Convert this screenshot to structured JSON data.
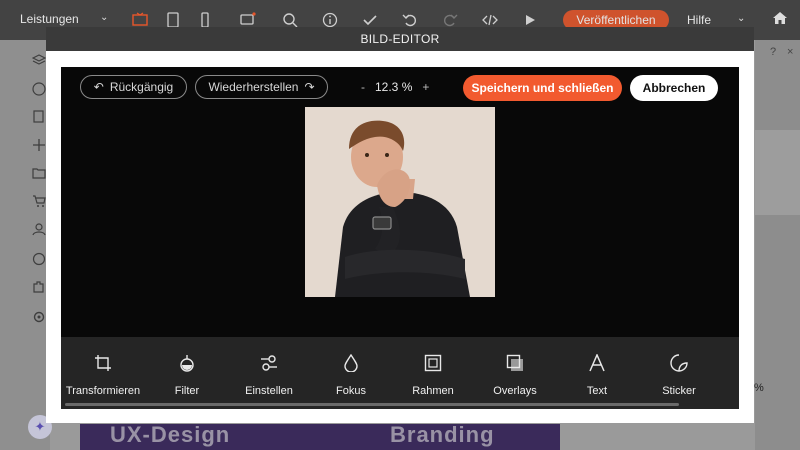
{
  "topbar": {
    "dropdown_label": "Leistungen",
    "publish_label": "Veröffentlichen",
    "help_label": "Hilfe",
    "icons": [
      "desktop-icon",
      "tablet-icon",
      "mobile-icon",
      "comment-icon",
      "search-icon",
      "info-icon",
      "check-icon",
      "undo-icon",
      "redo-icon",
      "code-icon",
      "play-icon",
      "home-icon"
    ],
    "accent_color": "#e8562a"
  },
  "sidebar": {
    "icons": [
      "layers-icon",
      "palette-icon",
      "pages-icon",
      "add-icon",
      "folder-icon",
      "cart-icon",
      "user-icon",
      "chat-icon",
      "puzzle-icon",
      "settings-icon",
      "magic-icon"
    ]
  },
  "right_panel": {
    "help": "?",
    "close": "×",
    "percent": "%"
  },
  "background_content": {
    "text_left": "UX-Design",
    "text_right": "Branding"
  },
  "modal": {
    "title": "BILD-EDITOR",
    "undo_label": "Rückgängig",
    "redo_label": "Wiederherstellen",
    "zoom_minus": "-",
    "zoom_value": "12.3 %",
    "zoom_plus": "+",
    "save_label": "Speichern und schließen",
    "cancel_label": "Abbrechen",
    "save_color": "#f25a2f",
    "tools": [
      {
        "label": "Transformieren",
        "icon": "crop-icon"
      },
      {
        "label": "Filter",
        "icon": "filter-icon"
      },
      {
        "label": "Einstellen",
        "icon": "adjust-icon"
      },
      {
        "label": "Fokus",
        "icon": "focus-drop-icon"
      },
      {
        "label": "Rahmen",
        "icon": "frame-icon"
      },
      {
        "label": "Overlays",
        "icon": "overlay-icon"
      },
      {
        "label": "Text",
        "icon": "text-icon"
      },
      {
        "label": "Sticker",
        "icon": "sticker-icon"
      }
    ]
  }
}
